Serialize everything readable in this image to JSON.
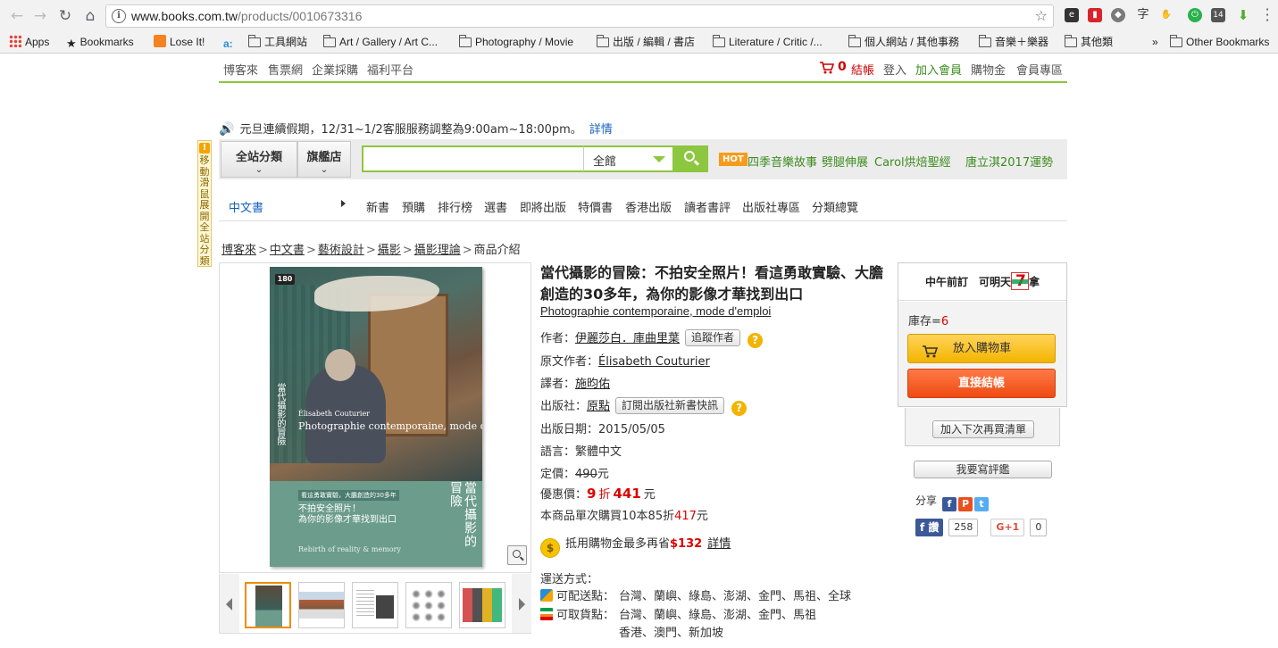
{
  "browser": {
    "url_host": "www.books.com.tw",
    "url_path": "/products/0010673316",
    "bookmarks": [
      {
        "label": "Apps",
        "icon": "apps-grid-icon"
      },
      {
        "label": "Bookmarks",
        "icon": "star-icon"
      },
      {
        "label": "Lose It!",
        "icon": "loseit-icon"
      },
      {
        "label": "",
        "icon": "ai-icon"
      },
      {
        "label": "工具網站",
        "icon": "folder-icon"
      },
      {
        "label": "Art / Gallery / Art C...",
        "icon": "folder-icon"
      },
      {
        "label": "Photography / Movie",
        "icon": "folder-icon"
      },
      {
        "label": "出版 / 編輯 / 書店",
        "icon": "folder-icon"
      },
      {
        "label": "Literature / Critic /...",
        "icon": "folder-icon"
      },
      {
        "label": "個人網站 / 其他事務",
        "icon": "folder-icon"
      },
      {
        "label": "音樂＋樂器",
        "icon": "folder-icon"
      },
      {
        "label": "其他類",
        "icon": "folder-icon"
      }
    ],
    "more_bookmarks": "»",
    "other_bookmarks": "Other Bookmarks",
    "ext_badge": "14"
  },
  "topnav": {
    "left": [
      "博客來",
      "售票網",
      "企業採購",
      "福利平台"
    ],
    "cart_count": "0",
    "checkout": "結帳",
    "login": "登入",
    "join": "加入會員",
    "credit": "購物金",
    "member": "會員專區"
  },
  "notice": {
    "text": "元旦連續假期，12/31~1/2客服服務調整為9:00am~18:00pm。",
    "link": "詳情"
  },
  "search": {
    "all_categories": "全站分類",
    "flagship": "旗艦店",
    "placeholder": "",
    "scope": "全館",
    "hot_badge": "HOT",
    "hot_links": [
      "四季音樂故事",
      "劈腿伸展",
      "Carol烘焙聖經",
      "唐立淇2017運勢"
    ]
  },
  "catnav": {
    "current": "中文書",
    "items": [
      "新書",
      "預購",
      "排行榜",
      "選書",
      "即將出版",
      "特價書",
      "香港出版",
      "讀者書評",
      "出版社專區",
      "分類總覽"
    ]
  },
  "side_tab": {
    "text": "移動滑鼠展開全站分類"
  },
  "breadcrumb": {
    "items": [
      "博客來",
      "中文書",
      "藝術設計",
      "攝影",
      "攝影理論"
    ],
    "current": "商品介紹",
    "sep": ">"
  },
  "cover": {
    "logo": "180",
    "spine": "當代攝影的冒險",
    "author": "Élisabeth Couturier",
    "subtitle": "Photographie contemporaine, mode d'emploi",
    "tag": "看這勇敢實驗，大膽創造的30多年",
    "lines": [
      "不拍安全照片！",
      "為你的影像才華找到出口"
    ],
    "vertical_title": "當代攝影的冒險",
    "rebirth": "Rebirth of reality & memory"
  },
  "product": {
    "title": "當代攝影的冒險：不拍安全照片！看這勇敢實驗、大膽創造的30多年，為你的影像才華找到出口",
    "original_title": "Photographie contemporaine, mode d'emploi",
    "author_label": "作者：",
    "author": "伊麗莎白．庫曲里葉",
    "follow_author": "追蹤作者",
    "orig_author_label": "原文作者：",
    "orig_author": "Élisabeth Couturier",
    "translator_label": "譯者：",
    "translator": "施昀佑",
    "publisher_label": "出版社：",
    "publisher": "原點",
    "subscribe_publisher": "訂閱出版社新書快訊",
    "pubdate_label": "出版日期：",
    "pubdate": "2015/05/05",
    "language_label": "語言：",
    "language": "繁體中文",
    "list_price_label": "定價：",
    "list_price": "490",
    "yuan": "元",
    "sale_label": "優惠價：",
    "discount": "9",
    "discount_unit": "折",
    "sale_price": "441",
    "bulk_prefix": "本商品單次購買10本85折",
    "bulk_price": "417",
    "credit_prefix": "抵用購物金最多再省",
    "credit_amount": "$132",
    "credit_link": "詳情",
    "shipping_label": "運送方式：",
    "deliver_label": "可配送點：",
    "deliver": "台灣、蘭嶼、綠島、澎湖、金門、馬祖、全球",
    "pickup_label": "可取貨點：",
    "pickup_line1": "台灣、蘭嶼、綠島、澎湖、金門、馬祖",
    "pickup_line2": "香港、澳門、新加坡"
  },
  "buybox": {
    "head_left": "中午前訂　可明天",
    "head_right": "拿",
    "stock_label": "庫存=",
    "stock": "6",
    "add_cart": "放入購物車",
    "checkout": "直接結帳",
    "wishlist": "加入下次再買清單",
    "review": "我要寫評鑑",
    "share": "分享",
    "fb_like": "讚",
    "fb_count": "258",
    "gplus": "G+1",
    "gplus_count": "0"
  },
  "colors": {
    "brand_green": "#8dc63f",
    "price_red": "#d00000",
    "cart_yellow": "#f3b400",
    "checkout_orange": "#ee4a12"
  }
}
